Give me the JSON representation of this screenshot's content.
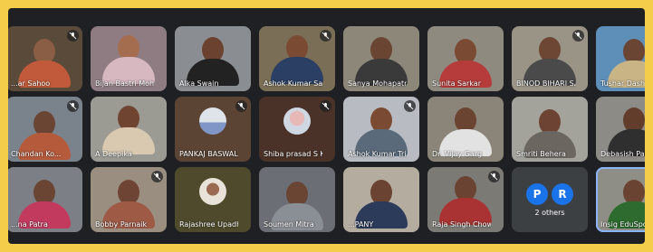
{
  "participants": [
    {
      "name": "...ar Sahoo",
      "muted": true
    },
    {
      "name": "Bijan Bastri Moha...",
      "muted": false
    },
    {
      "name": "Alka Swain",
      "muted": false
    },
    {
      "name": "Ashok Kumar Sahu",
      "muted": true
    },
    {
      "name": "Sanya Mohapatra",
      "muted": false
    },
    {
      "name": "Sunita Sarkar",
      "muted": false
    },
    {
      "name": "BINOD BIHARI SAW",
      "muted": true
    },
    {
      "name": "Tushar Dash",
      "muted": false
    },
    {
      "name": "Chandan Ko...",
      "muted": true
    },
    {
      "name": "A Deepika",
      "muted": false
    },
    {
      "name": "PANKAJ BASWAL",
      "muted": true
    },
    {
      "name": "Shiba prasad S K",
      "muted": true
    },
    {
      "name": "Ashok Kumar Tri...",
      "muted": true
    },
    {
      "name": "Dr. Vijay Garg",
      "muted": false
    },
    {
      "name": "Smriti Behera",
      "muted": false
    },
    {
      "name": "Debasish Parida",
      "muted": false
    },
    {
      "name": "...na Patra",
      "muted": false
    },
    {
      "name": "Bobby Parnaik",
      "muted": true
    },
    {
      "name": "Rajashree Upadha...",
      "muted": false
    },
    {
      "name": "Soumen Mitra",
      "muted": false
    },
    {
      "name": "...PANY",
      "muted": false
    },
    {
      "name": "Raja Singh Chowd...",
      "muted": true
    },
    {
      "name": "",
      "muted": false
    },
    {
      "name": "Insig EduSports L...",
      "muted": false
    }
  ],
  "others_tile": {
    "initials": [
      "P",
      "R"
    ],
    "label": "2 others"
  },
  "colors": {
    "border": "#f4cd4a",
    "background": "#1f2024",
    "accent": "#1a73e8"
  }
}
